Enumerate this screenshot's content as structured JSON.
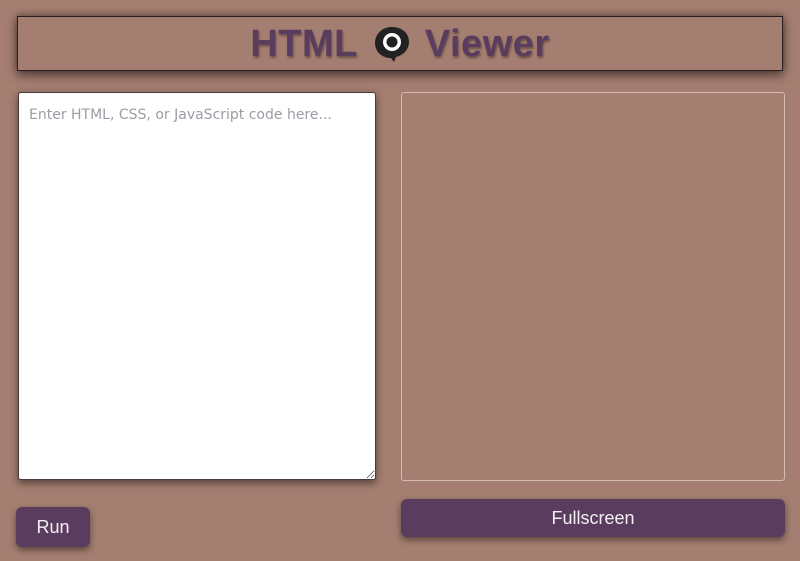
{
  "header": {
    "title_left": "HTML",
    "title_right": "Viewer",
    "icon": "speech-bubble-eye-icon",
    "title_color": "#5a3d5e"
  },
  "editor": {
    "placeholder": "Enter HTML, CSS, or JavaScript code here...",
    "value": ""
  },
  "buttons": {
    "run_label": "Run",
    "fullscreen_label": "Fullscreen"
  },
  "colors": {
    "background": "#a47e70",
    "button": "#5a3d5e",
    "button_text": "#f5eef5"
  }
}
